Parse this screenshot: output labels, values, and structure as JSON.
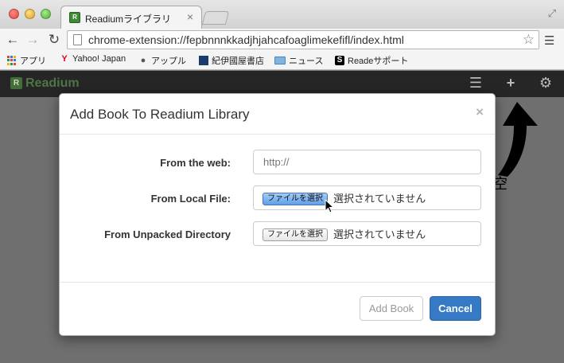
{
  "browser": {
    "tab_title": "Readiumライブラリ",
    "tab_close": "×",
    "url": "chrome-extension://fepbnnnkkadjhjahcafoaglimekefifl/index.html",
    "bookmarks": [
      {
        "label": "アプリ"
      },
      {
        "label": "Yahoo! Japan"
      },
      {
        "label": "アップル"
      },
      {
        "label": "紀伊國屋書店"
      },
      {
        "label": "ニュース"
      },
      {
        "label": "Readeサポート"
      }
    ]
  },
  "app": {
    "logo_text": "Readium",
    "background_hint": "空"
  },
  "modal": {
    "title": "Add Book To Readium Library",
    "close": "×",
    "fields": {
      "web_label": "From the web:",
      "web_placeholder": "http://",
      "local_label": "From Local File:",
      "local_button": "ファイルを選択",
      "local_status": "選択されていません",
      "dir_label": "From Unpacked Directory",
      "dir_button": "ファイルを選択",
      "dir_status": "選択されていません"
    },
    "footer": {
      "add_label": "Add Book",
      "cancel_label": "Cancel"
    }
  },
  "colors": {
    "primary_button": "#3679c4",
    "app_nav": "#262626",
    "logo_green": "#4f7547"
  }
}
